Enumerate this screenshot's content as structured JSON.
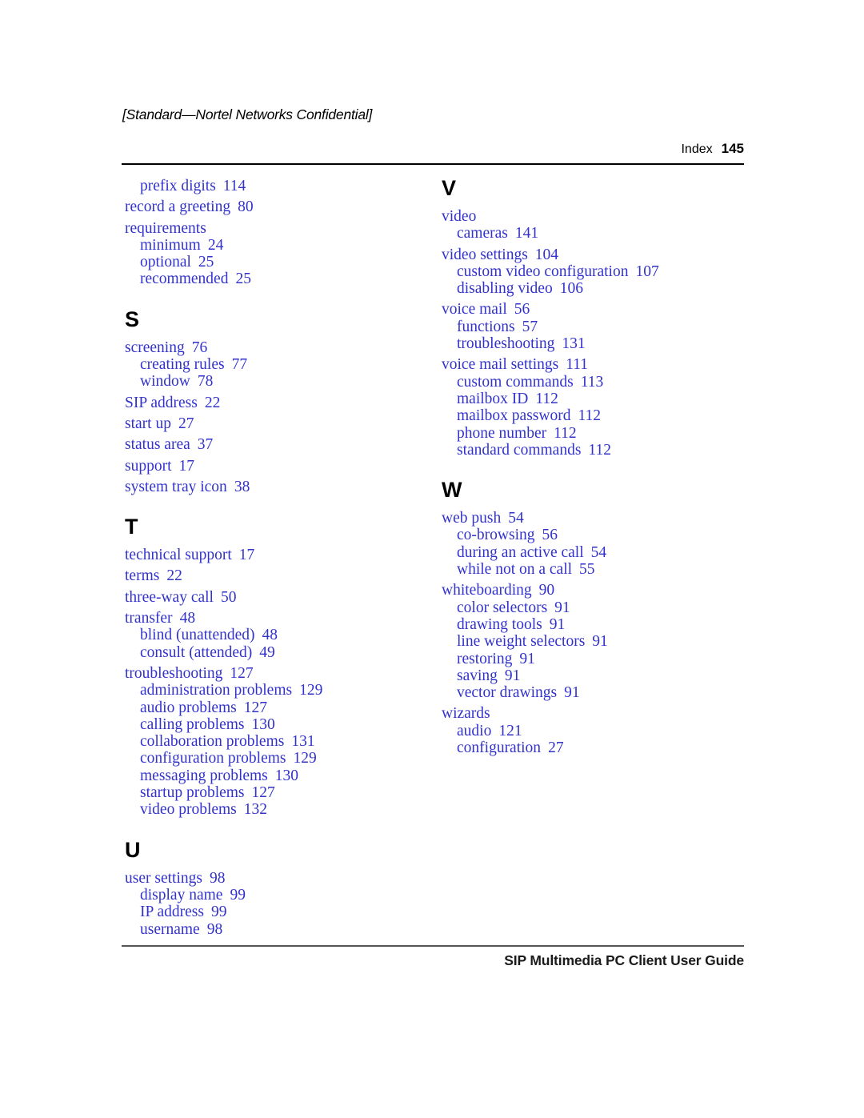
{
  "header": {
    "confidential": "[Standard—Nortel Networks Confidential]",
    "section_label": "Index",
    "page_number": "145"
  },
  "footer": {
    "guide_title": "SIP Multimedia PC Client User Guide"
  },
  "colors": {
    "entry_blue": "#3333CC",
    "text_black": "#000000",
    "rule": "#000000"
  },
  "columns": [
    {
      "name": "left-column",
      "blocks": [
        {
          "type": "entries",
          "entries": [
            {
              "level": 2,
              "text": "prefix digits",
              "page": "114"
            },
            {
              "level": 1,
              "text": "record a greeting",
              "page": "80"
            },
            {
              "level": 1,
              "text": "requirements",
              "page": ""
            },
            {
              "level": 2,
              "text": "minimum",
              "page": "24"
            },
            {
              "level": 2,
              "text": "optional",
              "page": "25"
            },
            {
              "level": 2,
              "text": "recommended",
              "page": "25"
            }
          ]
        },
        {
          "type": "section",
          "letter": "S",
          "entries": [
            {
              "level": 1,
              "text": "screening",
              "page": "76"
            },
            {
              "level": 2,
              "text": "creating rules",
              "page": "77"
            },
            {
              "level": 2,
              "text": "window",
              "page": "78"
            },
            {
              "level": 1,
              "text": "SIP address",
              "page": "22"
            },
            {
              "level": 1,
              "text": "start up",
              "page": "27"
            },
            {
              "level": 1,
              "text": "status area",
              "page": "37"
            },
            {
              "level": 1,
              "text": "support",
              "page": "17"
            },
            {
              "level": 1,
              "text": "system tray icon",
              "page": "38"
            }
          ]
        },
        {
          "type": "section",
          "letter": "T",
          "entries": [
            {
              "level": 1,
              "text": "technical support",
              "page": "17"
            },
            {
              "level": 1,
              "text": "terms",
              "page": "22"
            },
            {
              "level": 1,
              "text": "three-way call",
              "page": "50"
            },
            {
              "level": 1,
              "text": "transfer",
              "page": "48"
            },
            {
              "level": 2,
              "text": "blind (unattended)",
              "page": "48"
            },
            {
              "level": 2,
              "text": "consult (attended)",
              "page": "49"
            },
            {
              "level": 1,
              "text": "troubleshooting",
              "page": "127"
            },
            {
              "level": 2,
              "text": "administration problems",
              "page": "129"
            },
            {
              "level": 2,
              "text": "audio problems",
              "page": "127"
            },
            {
              "level": 2,
              "text": "calling problems",
              "page": "130"
            },
            {
              "level": 2,
              "text": "collaboration problems",
              "page": "131"
            },
            {
              "level": 2,
              "text": "configuration problems",
              "page": "129"
            },
            {
              "level": 2,
              "text": "messaging problems",
              "page": "130"
            },
            {
              "level": 2,
              "text": "startup problems",
              "page": "127"
            },
            {
              "level": 2,
              "text": "video problems",
              "page": "132"
            }
          ]
        },
        {
          "type": "section",
          "letter": "U",
          "entries": [
            {
              "level": 1,
              "text": "user settings",
              "page": "98"
            },
            {
              "level": 2,
              "text": "display name",
              "page": "99"
            },
            {
              "level": 2,
              "text": "IP address",
              "page": "99"
            },
            {
              "level": 2,
              "text": "username",
              "page": "98"
            }
          ]
        }
      ]
    },
    {
      "name": "right-column",
      "blocks": [
        {
          "type": "section",
          "letter": "V",
          "entries": [
            {
              "level": 1,
              "text": "video",
              "page": ""
            },
            {
              "level": 2,
              "text": "cameras",
              "page": "141"
            },
            {
              "level": 1,
              "text": "video settings",
              "page": "104"
            },
            {
              "level": 2,
              "text": "custom video configuration",
              "page": "107"
            },
            {
              "level": 2,
              "text": "disabling video",
              "page": "106"
            },
            {
              "level": 1,
              "text": "voice mail",
              "page": "56"
            },
            {
              "level": 2,
              "text": "functions",
              "page": "57"
            },
            {
              "level": 2,
              "text": "troubleshooting",
              "page": "131"
            },
            {
              "level": 1,
              "text": "voice mail settings",
              "page": "111"
            },
            {
              "level": 2,
              "text": "custom commands",
              "page": "113"
            },
            {
              "level": 2,
              "text": "mailbox ID",
              "page": "112"
            },
            {
              "level": 2,
              "text": "mailbox password",
              "page": "112"
            },
            {
              "level": 2,
              "text": "phone number",
              "page": "112"
            },
            {
              "level": 2,
              "text": "standard commands",
              "page": "112"
            }
          ]
        },
        {
          "type": "section",
          "letter": "W",
          "entries": [
            {
              "level": 1,
              "text": "web push",
              "page": "54"
            },
            {
              "level": 2,
              "text": "co-browsing",
              "page": "56"
            },
            {
              "level": 2,
              "text": "during an active call",
              "page": "54"
            },
            {
              "level": 2,
              "text": "while not on a call",
              "page": "55"
            },
            {
              "level": 1,
              "text": "whiteboarding",
              "page": "90"
            },
            {
              "level": 2,
              "text": "color selectors",
              "page": "91"
            },
            {
              "level": 2,
              "text": "drawing tools",
              "page": "91"
            },
            {
              "level": 2,
              "text": "line weight selectors",
              "page": "91"
            },
            {
              "level": 2,
              "text": "restoring",
              "page": "91"
            },
            {
              "level": 2,
              "text": "saving",
              "page": "91"
            },
            {
              "level": 2,
              "text": "vector drawings",
              "page": "91"
            },
            {
              "level": 1,
              "text": "wizards",
              "page": ""
            },
            {
              "level": 2,
              "text": "audio",
              "page": "121"
            },
            {
              "level": 2,
              "text": "configuration",
              "page": "27"
            }
          ]
        }
      ]
    }
  ]
}
